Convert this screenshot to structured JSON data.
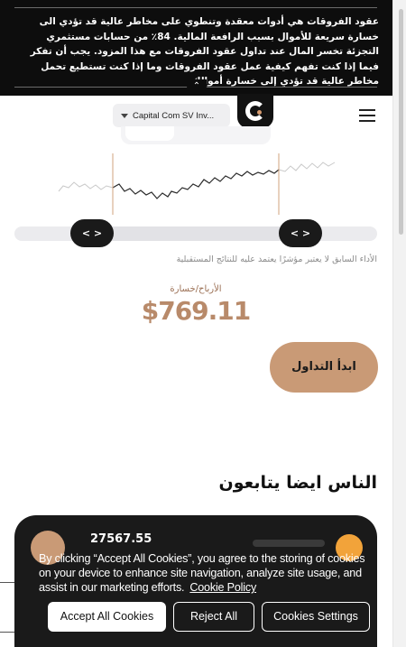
{
  "risk_banner": {
    "text": "عقود الفروقات هي أدوات معقدة وتنطوي على مخاطر عالية قد تؤدي الى خسارة سريعة للأموال بسبب الرافعة المالية. 84٪ من حسابات مستثمري التجزئة تخسر المال عند تداول عقود الفروقات مع هذا المزود. يجب أن تفكر فيما إذا كنت تفهم كيفية عمل عقود الفروقات وما إذا كنت تستطيع تحمل مخاطر عالية قد تؤدي إلى خسارة أموالك.",
    "collapse_icon": "double-chevron-up"
  },
  "header": {
    "entity_selector": "Capital Com SV Inv...",
    "logo": "capital-com-logo",
    "menu_icon": "hamburger"
  },
  "chart": {
    "range_handle_icon": "< >"
  },
  "disclaimer": "الأداء السابق لا يعتبر مؤشرًا يعتمد عليه للنتائج المستقبلية",
  "profit_loss": {
    "label": "الأرباح/خسارة",
    "value": "$769.11"
  },
  "start_trading_label": "ابدأ التداول",
  "people_follow_title": "الناس ايضا يتابعون",
  "trader_card": {
    "number": "27567.55"
  },
  "cookie_banner": {
    "text": "By clicking “Accept All Cookies”, you agree to the storing of cookies on your device to enhance site navigation, analyze site usage, and assist in our marketing efforts.",
    "policy_link": "Cookie Policy",
    "accept_label": "Accept All Cookies",
    "reject_label": "Reject All",
    "settings_label": "Cookies Settings"
  },
  "colors": {
    "banner_bg": "#0d0d0d",
    "accent": "#c99a76",
    "accent_text": "#b88a6a",
    "dark": "#1a1a1a"
  }
}
